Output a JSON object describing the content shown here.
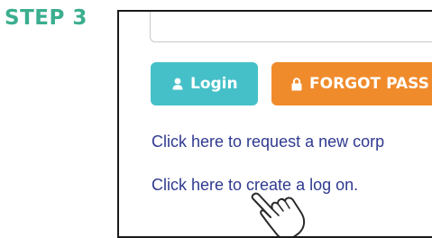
{
  "step": {
    "label": "STEP 3"
  },
  "buttons": {
    "login_label": "Login",
    "forgot_label": "FORGOT PASS"
  },
  "links": {
    "request_corp": "Click here to request a new corp",
    "create_logon": "Click here to create a log on."
  },
  "icons": {
    "login": "user-icon",
    "forgot": "lock-icon",
    "cursor": "pointing-hand-icon"
  },
  "colors": {
    "step_text": "#3aae8e",
    "login_button": "#46c0c8",
    "forgot_button": "#f08b2c",
    "link_text": "#2f3a8f",
    "frame_border": "#1a1a1a"
  }
}
